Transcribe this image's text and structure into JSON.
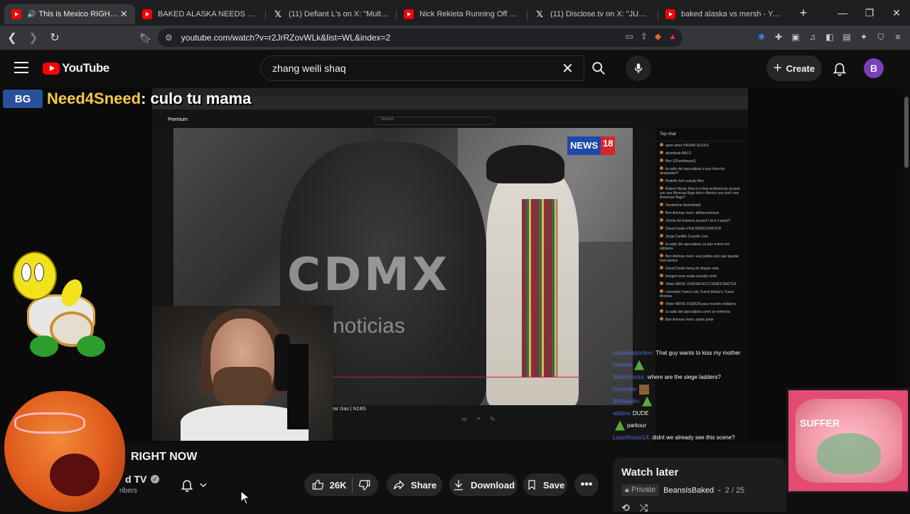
{
  "browser": {
    "tabs": [
      {
        "title": "This is Mexico RIGHT NOW",
        "favicon": "youtube",
        "active": true,
        "audio": true
      },
      {
        "title": "BAKED ALASKA NEEDS MILK! #y",
        "favicon": "youtube",
        "active": false
      },
      {
        "title": "(11) Defiant L's on X: \"Multiple n",
        "favicon": "x",
        "active": false
      },
      {
        "title": "Nick Rekieta Running Off Uncivil",
        "favicon": "youtube",
        "active": false
      },
      {
        "title": "(11) Disclose.tv on X: \"JUST IN -",
        "favicon": "x",
        "active": false
      },
      {
        "title": "baked alaska vs mersh - YouTube",
        "favicon": "youtube",
        "active": false
      }
    ],
    "url": "youtube.com/watch?v=r2JrRZovWLk&list=WL&index=2"
  },
  "youtube": {
    "logo_text": "YouTube",
    "search_value": "zhang weili shaq",
    "create_label": "Create",
    "avatar_letter": "B"
  },
  "overlay": {
    "stream_logo": "BG",
    "stream_user": "Need4Sneed",
    "stream_message": ": culo tu mama",
    "news_badge_a": "NEWS",
    "news_badge_b": "18",
    "watermark_main": "CDMX",
    "watermark_sub": "noticias",
    "inner_caption": "ear Gas | N18G",
    "inner_header": "Premium",
    "inner_search": "Search",
    "inner_chat_header": "Top chat",
    "inner_chat_lines": [
      "sport steer HASAN SUCKS",
      "akomibab BALD",
      "Ben {{Shrekbaum}}",
      "la radio del apocalipsis a que hora les tampantan?",
      "Rodolfo heh exactly Ben",
      "Robert Hinnis How is it that at American protest you see Mexican flags but in Mexico you don't see American flags?",
      "Vendetime Awmmbaid",
      "Ben Animae more: allthecommissi",
      "Johnie No Kamera around I isn't it weird?",
      "David Davila VIVA DEMOCRATICA",
      "Jorge Castillo Cuando Lina",
      "la radio del apocalipsis ya que entren los militares",
      "Ben Animae more: esa pedira solo que quedar mal mexico",
      "David Davila living de Mayan vida",
      "bongert wow sadla actually work",
      "Vikter MRVE VIVA MEXICO DEMOCRATICA",
      "Leonardo Fuera Lola, Fuera Maduro, Fuera Morena",
      "Vikter MRVE FUERZA para nuestro militares",
      "la radio del apocalipsis como se enfrenta",
      "Ben Animae more: pobre jente"
    ],
    "chat_feed": [
      {
        "user": "sundaeabortion:",
        "text": "That guy wants to kiss my mother"
      },
      {
        "user": "DotNub",
        "text": ""
      },
      {
        "user": "Smithyrocks:",
        "text": "where are the siege ladders?"
      },
      {
        "user": "furryhater",
        "text": ""
      },
      {
        "user": "SirMaddin:",
        "text": ""
      },
      {
        "user": "alsbinx",
        "text": "DUDE"
      },
      {
        "user": "",
        "text": "parkour"
      },
      {
        "user": "LazerRazer14:",
        "text": "didnt we already see this scene?"
      }
    ],
    "suffer_label": "SUFFER"
  },
  "video": {
    "title": "RIGHT NOW",
    "channel": "d TV",
    "subscribers": "ribers",
    "likes": "26K",
    "share_label": "Share",
    "download_label": "Download",
    "save_label": "Save"
  },
  "playlist": {
    "title": "Watch later",
    "privacy": "Private",
    "owner": "BeansIsBaked",
    "position": "2 / 25"
  },
  "colors": {
    "youtube_red": "#ff0000",
    "stream_name_gold": "#f7c948",
    "chat_user_blue": "#4f6bd8"
  }
}
